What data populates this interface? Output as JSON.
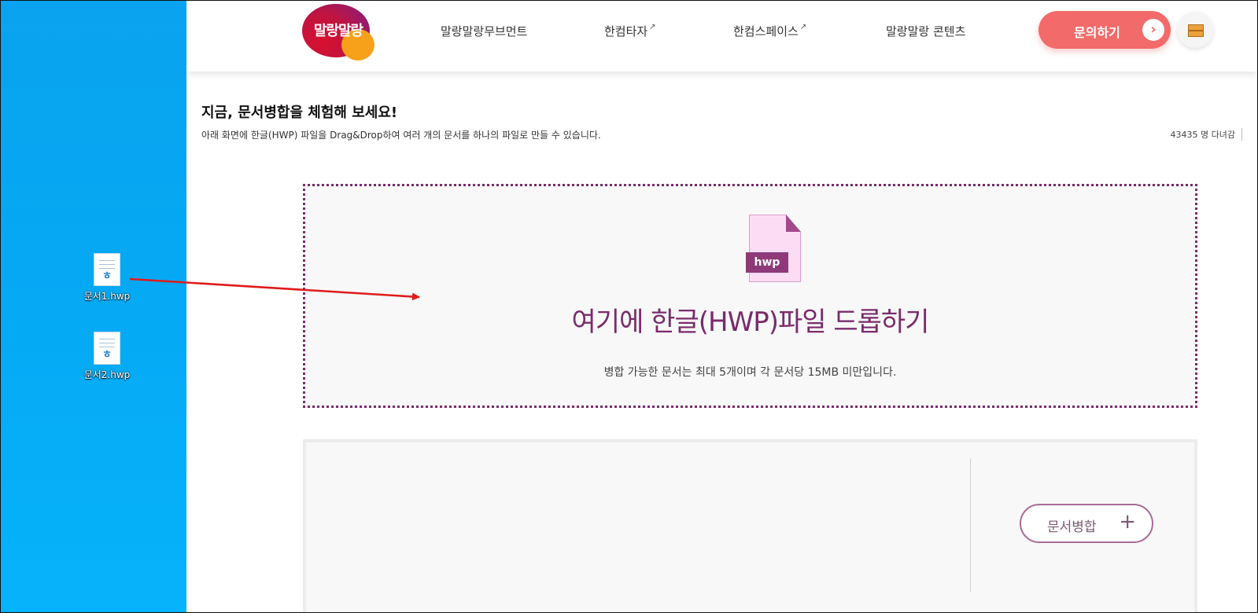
{
  "desktop": {
    "files": [
      {
        "name": "문서1.hwp",
        "icon": "hwp-file-icon",
        "glyph": "ㅎ"
      },
      {
        "name": "문서2.hwp",
        "icon": "hwp-file-icon",
        "glyph": "ㅎ"
      }
    ]
  },
  "header": {
    "logo_text": "말랑말랑",
    "nav": [
      {
        "label": "말랑말랑무브먼트",
        "external": false
      },
      {
        "label": "한컴타자",
        "external": true
      },
      {
        "label": "한컴스페이스",
        "external": true
      },
      {
        "label": "말랑말랑 콘텐츠",
        "external": false
      }
    ],
    "external_glyph": "↗",
    "cta_label": "문의하기",
    "cta_arrow": "›"
  },
  "intro": {
    "title": "지금, 문서병합을 체험해 보세요!",
    "subtitle": "아래 화면에 한글(HWP) 파일을 Drag&Drop하여 여러 개의 문서를 하나의 파일로 만들 수 있습니다.",
    "visitors": "43435 명 다녀감"
  },
  "dropzone": {
    "file_tag": "hwp",
    "title": "여기에 한글(HWP)파일 드롭하기",
    "note": "병합 가능한 문서는 최대 5개이며 각 문서당 15MB  미만입니다."
  },
  "merge": {
    "button_label": "문서병합",
    "plus": "+"
  },
  "colors": {
    "accent": "#7a2b6c",
    "cta": "#f26a6a",
    "arrow": "#e01b1b"
  }
}
